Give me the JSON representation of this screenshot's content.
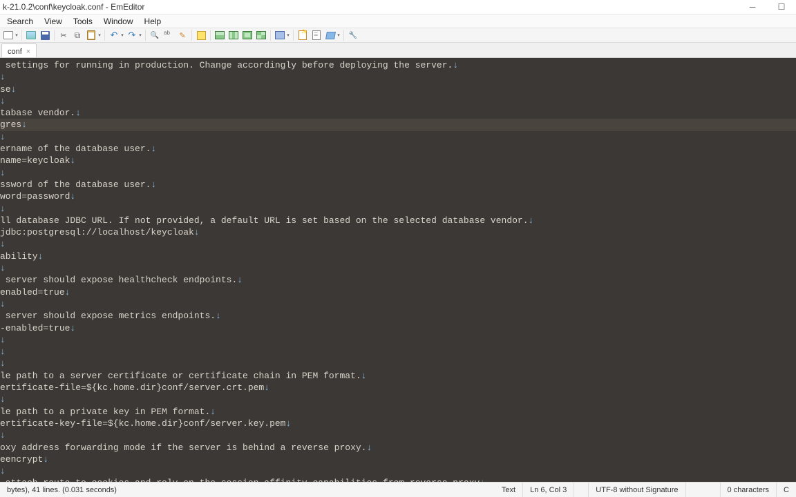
{
  "title": "k-21.0.2\\conf\\keycloak.conf - EmEditor",
  "menu": [
    "Search",
    "View",
    "Tools",
    "Window",
    "Help"
  ],
  "tab": {
    "label": "conf"
  },
  "editor": {
    "current_line_index": 5,
    "lines": [
      " settings for running in production. Change accordingly before deploying the server.",
      "",
      "se",
      "",
      "tabase vendor.",
      "gres",
      "",
      "ername of the database user.",
      "name=keycloak",
      "",
      "ssword of the database user.",
      "word=password",
      "",
      "ll database JDBC URL. If not provided, a default URL is set based on the selected database vendor.",
      "jdbc:postgresql://localhost/keycloak",
      "",
      "ability",
      "",
      " server should expose healthcheck endpoints.",
      "enabled=true",
      "",
      " server should expose metrics endpoints.",
      "-enabled=true",
      "",
      "",
      "",
      "le path to a server certificate or certificate chain in PEM format.",
      "ertificate-file=${kc.home.dir}conf/server.crt.pem",
      "",
      "le path to a private key in PEM format.",
      "ertificate-key-file=${kc.home.dir}conf/server.key.pem",
      "",
      "oxy address forwarding mode if the server is behind a reverse proxy.",
      "eencrypt",
      "",
      " attach route to cookies and rely on the session affinity capabilities from reverse proxy"
    ]
  },
  "eol": "↓",
  "status": {
    "left": " bytes), 41 lines. (0.031 seconds)",
    "mode": "Text",
    "pos": "Ln 6, Col 3",
    "encoding": "UTF-8 without Signature",
    "chars": "0 characters",
    "ovr": "C"
  }
}
